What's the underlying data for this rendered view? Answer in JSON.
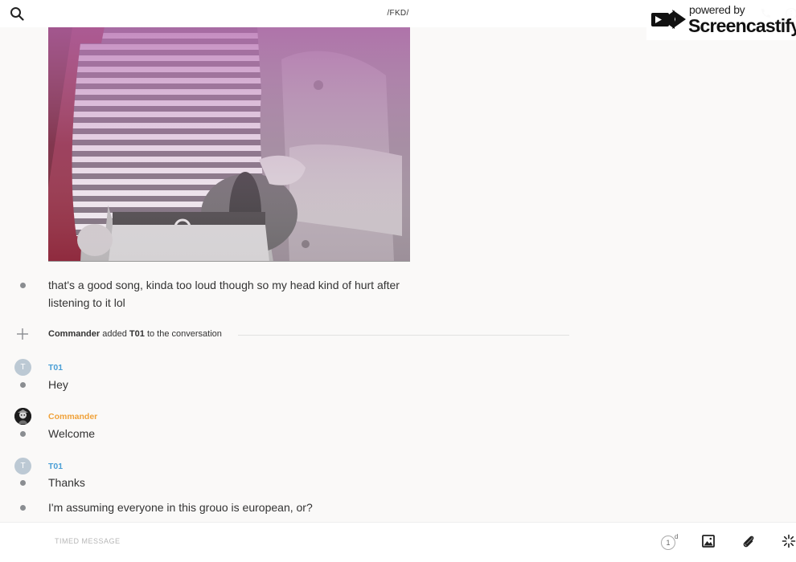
{
  "header": {
    "title": "/FKD/",
    "search_icon": "search-icon",
    "call_icon": "phone-icon",
    "info_icon": "info-icon"
  },
  "watermark": {
    "powered_by": "powered by",
    "brand": "Screencastify"
  },
  "messages": [
    {
      "text_line1": "that's a good song, kinda too loud though so my head kind of hurt after",
      "text_line2": "listening to it lol"
    }
  ],
  "system_event": {
    "actor": "Commander",
    "action": "added",
    "target": "T01",
    "suffix": "to the conversation"
  },
  "groups": [
    {
      "sender": "T01",
      "avatar_initial": "T",
      "text": "Hey"
    },
    {
      "sender": "Commander",
      "text": "Welcome"
    },
    {
      "sender": "T01",
      "avatar_initial": "T",
      "texts": [
        "Thanks",
        "I'm assuming everyone in this grouo is european, or?"
      ]
    }
  ],
  "composer": {
    "placeholder": "TIMED MESSAGE",
    "timer_value": "1",
    "timer_unit": "d"
  },
  "colors": {
    "t01": "#4a9fd6",
    "commander": "#f0a23a",
    "background": "#faf9f8"
  }
}
